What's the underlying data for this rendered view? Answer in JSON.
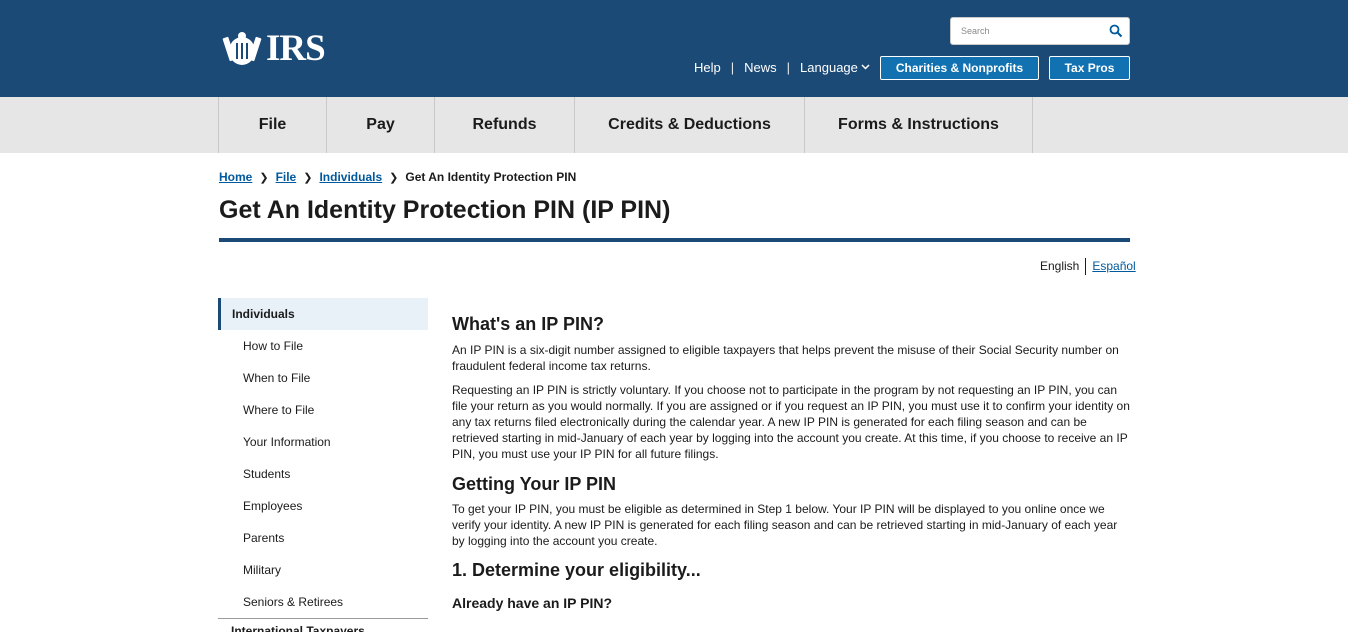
{
  "header": {
    "logo_text": "IRS",
    "search_placeholder": "Search",
    "utility_links": [
      "Help",
      "News",
      "Language"
    ],
    "buttons": [
      "Charities & Nonprofits",
      "Tax Pros"
    ]
  },
  "main_nav": [
    "File",
    "Pay",
    "Refunds",
    "Credits & Deductions",
    "Forms & Instructions"
  ],
  "breadcrumb": {
    "links": [
      "Home",
      "File",
      "Individuals"
    ],
    "current": "Get An Identity Protection PIN"
  },
  "page_title": "Get An Identity Protection PIN (IP PIN)",
  "language_switch": {
    "current": "English",
    "other": "Español"
  },
  "side_nav": {
    "heading": "Individuals",
    "items": [
      "How to File",
      "When to File",
      "Where to File",
      "Your Information",
      "Students",
      "Employees",
      "Parents",
      "Military",
      "Seniors & Retirees"
    ],
    "next_partial": "International Taxpayers"
  },
  "content": {
    "h_what": "What's an IP PIN?",
    "p1": "An IP PIN is a six-digit number assigned to eligible taxpayers that helps prevent the misuse of their Social Security number on fraudulent federal income tax returns.",
    "p2": "Requesting an IP PIN is strictly voluntary. If you choose not to participate in the program by not requesting an IP PIN, you can file your return as you would normally. If you are assigned or if you request an IP PIN, you must use it to confirm your identity on any tax returns filed electronically during the calendar year.  A new IP PIN is generated for each filing season and can be retrieved starting in mid-January of each year by logging into the account you create. At this time, if you choose to receive an IP PIN, you must use your IP PIN for all future filings.",
    "h_getting": "Getting Your IP PIN",
    "p3": "To get your IP PIN, you must be eligible as determined in Step 1 below. Your IP PIN will be displayed to you online once we verify your identity.  A new IP PIN is generated for each filing season and can be retrieved starting in mid-January of each year by logging into the account you create.",
    "h_step1": "1. Determine your eligibility...",
    "h_already": "Already have an IP PIN?"
  },
  "colors": {
    "header_bg": "#1b4a76",
    "nav_bg": "#e6e6e6",
    "link": "#00599c",
    "button_bg": "#1171b1",
    "sidenav_active_bg": "#e9f1f8"
  }
}
